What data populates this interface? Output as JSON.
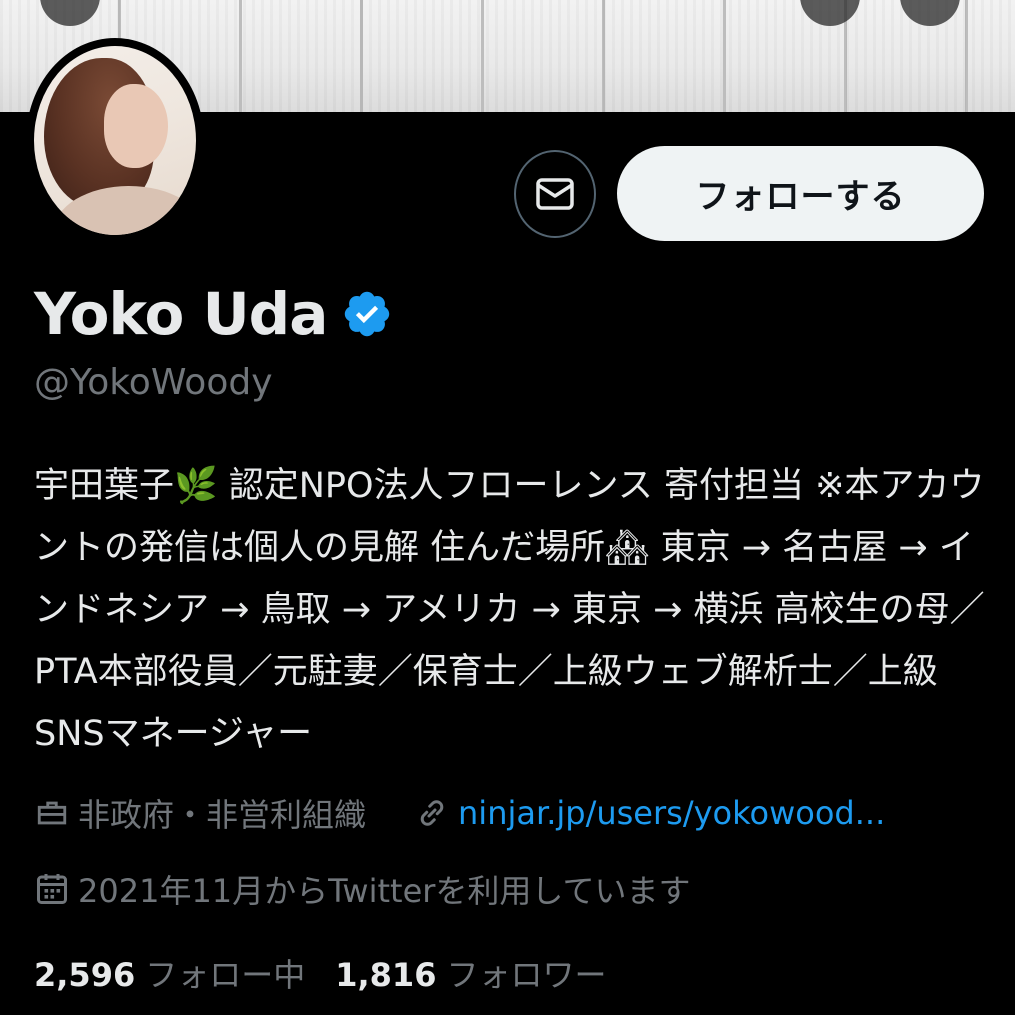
{
  "profile": {
    "display_name": "Yoko Uda",
    "handle": "@YokoWoody",
    "verified_icon": "verified-badge-icon",
    "follow_label": "フォローする",
    "message_icon": "envelope-icon",
    "bio": "宇田葉子🌿 認定NPO法人フローレンス 寄付担当 ※本アカウントの発信は個人の見解 住んだ場所🏘 東京 → 名古屋 → インドネシア → 鳥取 → アメリカ → 東京 → 横浜 高校生の母／PTA本部役員／元駐妻／保育士／上級ウェブ解析士／上級SNSマネージャー",
    "category": "非政府・非営利組織",
    "website": "ninjar.jp/users/yokowood...",
    "joined": "2021年11月からTwitterを利用しています",
    "following_count": "2,596",
    "following_label": "フォロー中",
    "followers_count": "1,816",
    "followers_label": "フォロワー"
  },
  "colors": {
    "background": "#000000",
    "text_primary": "#e7e9ea",
    "text_secondary": "#71767b",
    "link": "#1d9bf0",
    "verified": "#1d9bf0",
    "follow_button_bg": "#eff3f4"
  }
}
